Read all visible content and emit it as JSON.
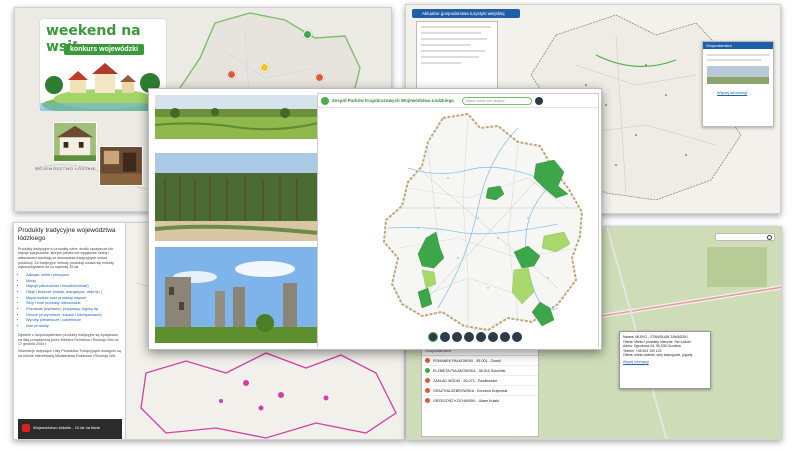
{
  "weekend": {
    "logo_title": "weekend na wsi",
    "logo_mark": "®",
    "logo_subtitle": "konkurs wojewódzki",
    "region_label": "WOJEWÓDZTWO ŁÓDZKIE"
  },
  "topright": {
    "tab_title": "Aktualne gospodarstwa turystyki wiejskiej",
    "popup_title": "Gospodarstwo",
    "popup_link": "Więcej informacji"
  },
  "products": {
    "title": "Produkty tradycyjne województwa łódzkiego",
    "intro": "Produkty tradycyjne to produkty rolne, środki spożywcze lub napoje spirytusowe, których jakość lub wyjątkowe cechy i właściwości wynikają ze stosowania tradycyjnych metod produkcji. Za tradycyjne metody produkcji uważa się metody wykorzystywane od co najmniej 25 lat.",
    "list": [
      "Zakwas, chleb i pieczywo",
      "Miody",
      "Napoje (alkoholowe i bezalkoholowe)",
      "Oleje i tłuszcze (masło, margaryna, oleje itp.)",
      "Mięso świeże oraz produkty mięsne",
      "Sery i inne produkty mleczarskie",
      "Pozostałe (wybrane): przyprawy, bigosy itp.",
      "Owoce (w wyrobach, sokach i kandyzowane)",
      "Wyroby piekarnicze i cukiernicze",
      "inne produkty"
    ],
    "note": "Zgodnie z rozporządzeniem produkty tradycyjne są wpisywane na listę prowadzoną przez Ministra Rolnictwa i Rozwoju Wsi od 17 grudnia 2004 r.",
    "footer": "Informacje dotyczące Listy Produktów Tradycyjnych dostępne są na stronie internetowej Ministerstwa Rolnictwa i Rozwoju Wsi.",
    "video_title": "Województwo łódzkie - 10 lat na liście"
  },
  "main": {
    "app_title": "Zespół Parków Krajobrazowych Województwa Łódzkiego",
    "search_placeholder": "Wpisz adres lub miejsce"
  },
  "bottomright": {
    "popup_lines": [
      "Nazwa: MLEKO - STANISŁAW ZAWADZKI",
      "Oferta: Mleko i produkty mleczne, Ser Łódzki",
      "Adres: Ogrodowa 54, 95-035 Ozorków",
      "Telefon: +48 604 100 123",
      "Oferta: mleko świeże, sery twarogowe, jogurty"
    ],
    "popup_link": "Więcej informacji",
    "list_header": "Gospodarstwa",
    "list": [
      "ROMANEK PAŁKOWSKI - 95-001 - Ozorki",
      "ELŻBIETA PUŁAKOWSKA - 98-510 Sokolniki",
      "ZAKŁAD WÓDKI - 95-073 - Pawlikowice",
      "GRAŻYNA ŻEBROWSKA - Korczew Krajewski",
      "GRZEGORZ KOCHAŃSKI - Ulane Kułaki"
    ]
  },
  "colors": {
    "accent_green": "#4caf50",
    "park_green": "#3da648",
    "park_light": "#a8d86b",
    "border_beige": "#bfa77a",
    "route_magenta": "#d43fa5",
    "button_bg": "#2d3a4a"
  }
}
